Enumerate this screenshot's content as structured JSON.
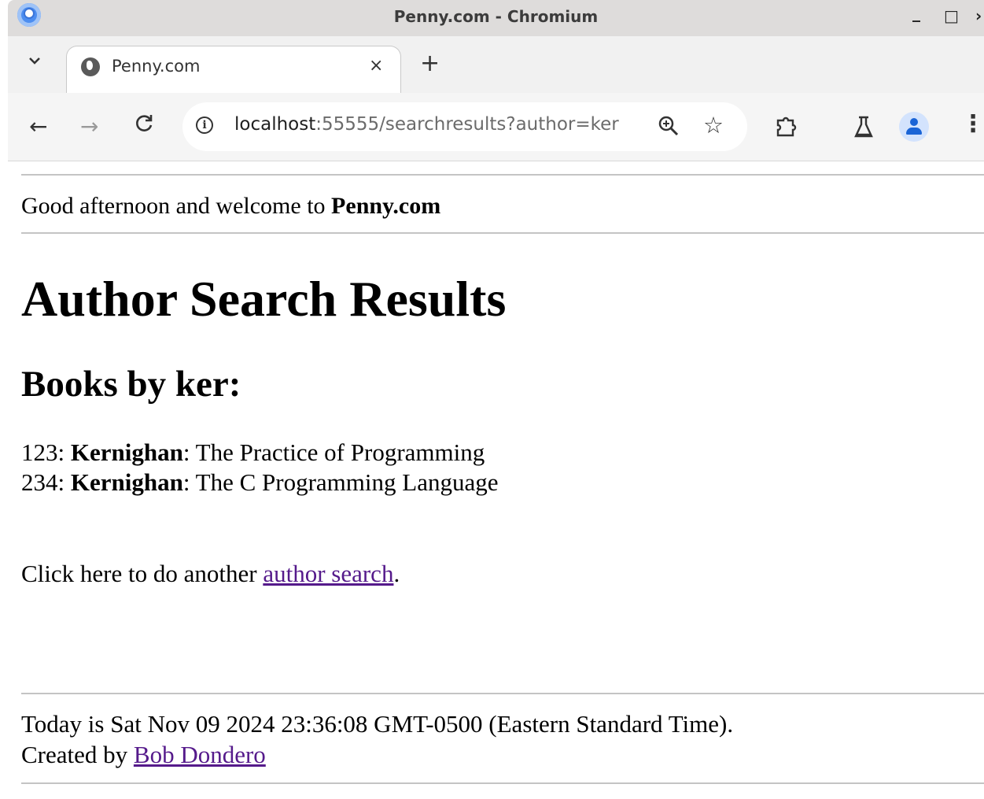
{
  "window": {
    "title": "Penny.com - Chromium",
    "minimize": "_",
    "maximize": "□",
    "close": "×"
  },
  "tab": {
    "title": "Penny.com",
    "close": "×",
    "new_tab": "+"
  },
  "toolbar": {
    "back": "←",
    "forward": "→",
    "reload": "C",
    "url_host": "localhost",
    "url_rest": ":55555/searchresults?author=ker",
    "zoom": "🔍",
    "bookmark": "☆",
    "menu": "⋮"
  },
  "page": {
    "greeting_prefix": "Good afternoon and welcome to ",
    "greeting_site": "Penny.com",
    "heading": "Author Search Results",
    "subheading": "Books by ker:",
    "books": [
      {
        "id": "123",
        "author": "Kernighan",
        "title": "The Practice of Programming"
      },
      {
        "id": "234",
        "author": "Kernighan",
        "title": "The C Programming Language"
      }
    ],
    "again_prefix": "Click here to do another ",
    "again_link": "author search",
    "again_suffix": ".",
    "date_line": "Today is Sat Nov 09 2024 23:36:08 GMT-0500 (Eastern Standard Time).",
    "credit_prefix": "Created by ",
    "credit_link": "Bob Dondero"
  }
}
